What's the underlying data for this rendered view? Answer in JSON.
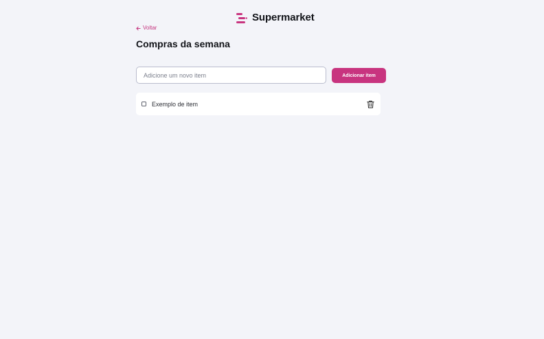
{
  "header": {
    "brand_name": "Supermarket",
    "logo_icon": "list-lines-icon"
  },
  "nav": {
    "back_label": "Voltar",
    "back_icon": "arrow-left-icon"
  },
  "page": {
    "title": "Compras da semana"
  },
  "add_form": {
    "input_value": "",
    "input_placeholder": "Adicione um novo item",
    "button_label": "Adicionar item"
  },
  "items": [
    {
      "label": "Exemplo de item",
      "checked": false,
      "delete_icon": "trash-icon"
    }
  ],
  "colors": {
    "accent": "#c8347f",
    "background": "#f3f4f9",
    "card": "#ffffff",
    "text": "#111318"
  }
}
